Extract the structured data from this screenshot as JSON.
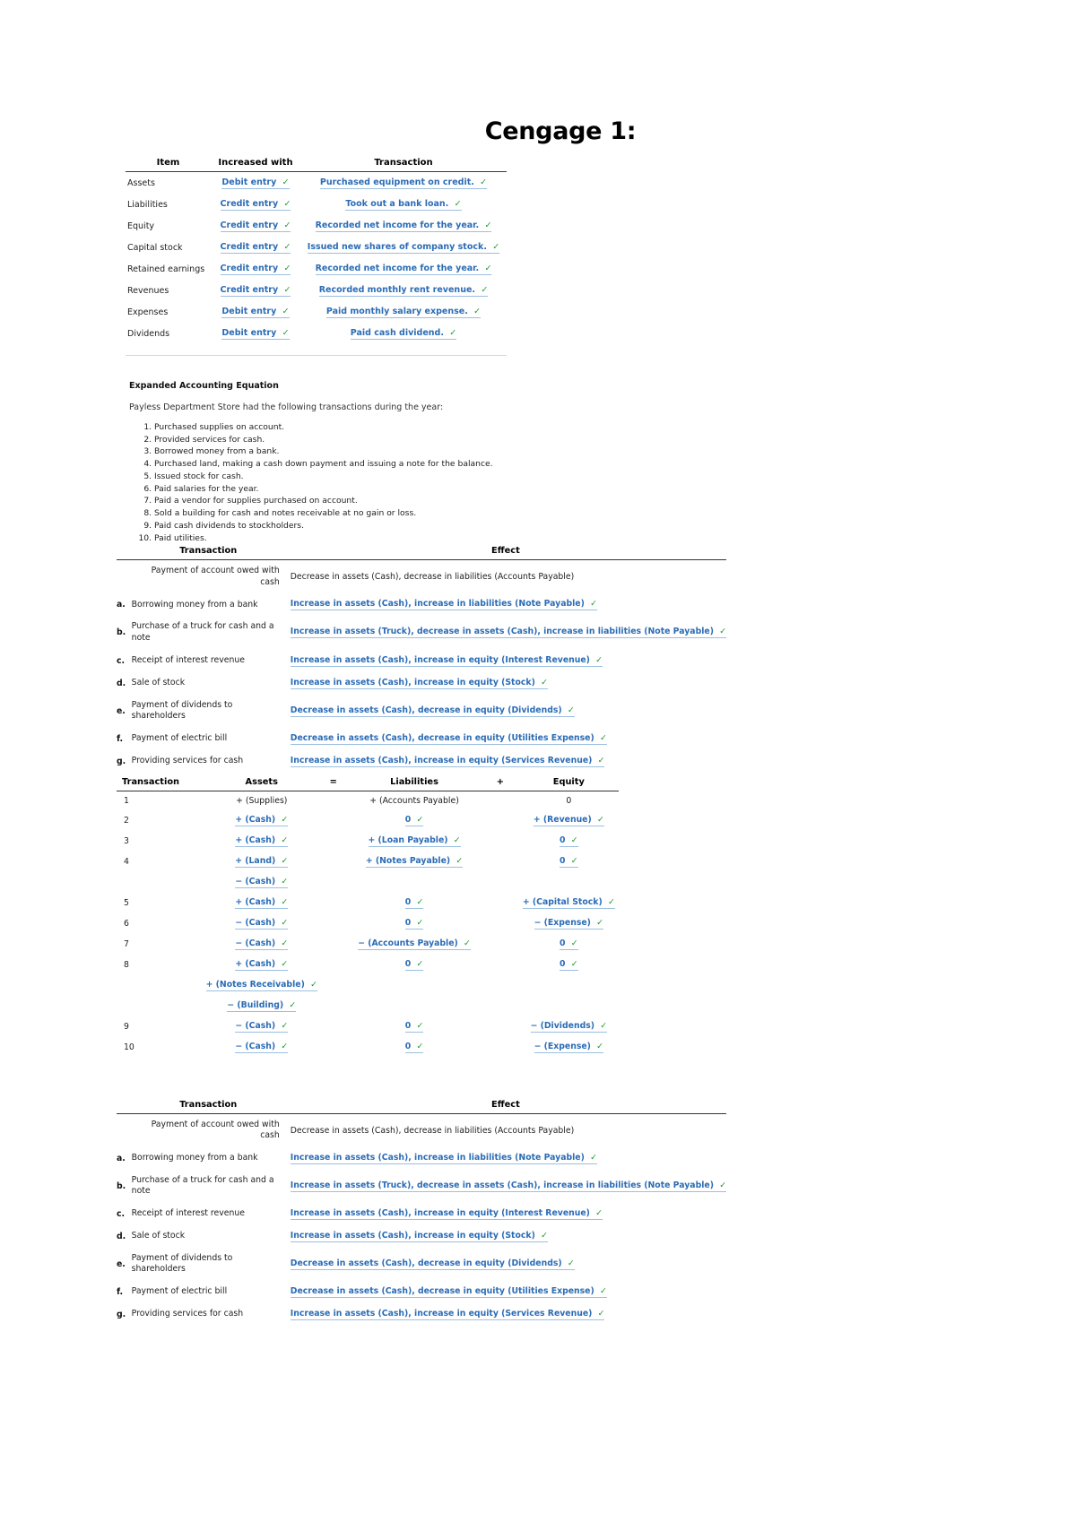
{
  "page": {
    "title": "Cengage 1:"
  },
  "colors": {
    "answer_blue": "#2b6cb6",
    "check_green": "#1d9b2f",
    "rule_dark": "#333333",
    "underline_blue": "#9cbfe0"
  },
  "icons": {
    "check": "✓"
  },
  "table_items": {
    "headers": [
      "Item",
      "Increased with",
      "Transaction"
    ],
    "rows": [
      {
        "item": "Assets",
        "increased_with": "Debit entry",
        "transaction": "Purchased equipment on credit."
      },
      {
        "item": "Liabilities",
        "increased_with": "Credit entry",
        "transaction": "Took out a bank loan."
      },
      {
        "item": "Equity",
        "increased_with": "Credit entry",
        "transaction": "Recorded net income for the year."
      },
      {
        "item": "Capital stock",
        "increased_with": "Credit entry",
        "transaction": "Issued new shares of company stock."
      },
      {
        "item": "Retained earnings",
        "increased_with": "Credit entry",
        "transaction": "Recorded net income for the year."
      },
      {
        "item": "Revenues",
        "increased_with": "Credit entry",
        "transaction": "Recorded monthly rent revenue."
      },
      {
        "item": "Expenses",
        "increased_with": "Debit entry",
        "transaction": "Paid monthly salary expense."
      },
      {
        "item": "Dividends",
        "increased_with": "Debit entry",
        "transaction": "Paid cash dividend."
      }
    ]
  },
  "expanded_section": {
    "heading": "Expanded Accounting Equation",
    "intro": "Payless Department Store had the following transactions during the year:",
    "transactions": [
      "Purchased supplies on account.",
      "Provided services for cash.",
      "Borrowed money from a bank.",
      "Purchased land, making a cash down payment and issuing a note for the balance.",
      "Issued stock for cash.",
      "Paid salaries for the year.",
      "Paid a vendor for supplies purchased on account.",
      "Sold a building for cash and notes receivable at no gain or loss.",
      "Paid cash dividends to stockholders.",
      "Paid utilities."
    ]
  },
  "effect_table": {
    "headers": [
      "Transaction",
      "Effect"
    ],
    "example": {
      "transaction": "Payment of account owed with cash",
      "effect": "Decrease in assets (Cash), decrease in liabilities (Accounts Payable)"
    },
    "rows": [
      {
        "label": "a.",
        "transaction": "Borrowing money from a bank",
        "effect": "Increase in assets (Cash), increase in liabilities (Note Payable)"
      },
      {
        "label": "b.",
        "transaction": "Purchase of a truck for cash and a note",
        "effect": "Increase in assets (Truck), decrease in assets (Cash), increase in liabilities (Note Payable)"
      },
      {
        "label": "c.",
        "transaction": "Receipt of interest revenue",
        "effect": "Increase in assets (Cash), increase in equity (Interest Revenue)"
      },
      {
        "label": "d.",
        "transaction": "Sale of stock",
        "effect": "Increase in assets (Cash), increase in equity (Stock)"
      },
      {
        "label": "e.",
        "transaction": "Payment of dividends to shareholders",
        "effect": "Decrease in assets (Cash), decrease in equity (Dividends)"
      },
      {
        "label": "f.",
        "transaction": "Payment of electric bill",
        "effect": "Decrease in assets (Cash), decrease in equity (Utilities Expense)"
      },
      {
        "label": "g.",
        "transaction": "Providing services for cash",
        "effect": "Increase in assets (Cash), increase in equity (Services Revenue)"
      }
    ]
  },
  "equation_table": {
    "headers": [
      "Transaction",
      "Assets",
      "=",
      "Liabilities",
      "+",
      "Equity"
    ],
    "rows": [
      {
        "n": "1",
        "assets": "+ (Supplies)",
        "liabilities": "+ (Accounts Payable)",
        "equity": "0",
        "answered": false
      },
      {
        "n": "2",
        "assets": "+ (Cash)",
        "liabilities": "0",
        "equity": "+ (Revenue)",
        "answered": true
      },
      {
        "n": "3",
        "assets": "+ (Cash)",
        "liabilities": "+ (Loan Payable)",
        "equity": "0",
        "answered": true
      },
      {
        "n": "4",
        "assets": "+ (Land)",
        "liabilities": "+ (Notes Payable)",
        "equity": "0",
        "answered": true
      },
      {
        "n": "",
        "assets": "− (Cash)",
        "liabilities": "",
        "equity": "",
        "answered": true
      },
      {
        "n": "5",
        "assets": "+ (Cash)",
        "liabilities": "0",
        "equity": "+ (Capital Stock)",
        "answered": true
      },
      {
        "n": "6",
        "assets": "− (Cash)",
        "liabilities": "0",
        "equity": "− (Expense)",
        "answered": true
      },
      {
        "n": "7",
        "assets": "− (Cash)",
        "liabilities": "− (Accounts Payable)",
        "equity": "0",
        "answered": true
      },
      {
        "n": "8",
        "assets": "+ (Cash)",
        "liabilities": "0",
        "equity": "0",
        "answered": true
      },
      {
        "n": "",
        "assets": "+ (Notes Receivable)",
        "liabilities": "",
        "equity": "",
        "answered": true
      },
      {
        "n": "",
        "assets": "− (Building)",
        "liabilities": "",
        "equity": "",
        "answered": true
      },
      {
        "n": "9",
        "assets": "− (Cash)",
        "liabilities": "0",
        "equity": "− (Dividends)",
        "answered": true
      },
      {
        "n": "10",
        "assets": "− (Cash)",
        "liabilities": "0",
        "equity": "− (Expense)",
        "answered": true
      }
    ]
  },
  "effect_table_2": {
    "headers": [
      "Transaction",
      "Effect"
    ],
    "example": {
      "transaction": "Payment of account owed with cash",
      "effect": "Decrease in assets (Cash), decrease in liabilities (Accounts Payable)"
    },
    "rows": [
      {
        "label": "a.",
        "transaction": "Borrowing money from a bank",
        "effect": "Increase in assets (Cash), increase in liabilities (Note Payable)"
      },
      {
        "label": "b.",
        "transaction": "Purchase of a truck for cash and a note",
        "effect": "Increase in assets (Truck), decrease in assets (Cash), increase in liabilities (Note Payable)"
      },
      {
        "label": "c.",
        "transaction": "Receipt of interest revenue",
        "effect": "Increase in assets (Cash), increase in equity (Interest Revenue)"
      },
      {
        "label": "d.",
        "transaction": "Sale of stock",
        "effect": "Increase in assets (Cash), increase in equity (Stock)"
      },
      {
        "label": "e.",
        "transaction": "Payment of dividends to shareholders",
        "effect": "Decrease in assets (Cash), decrease in equity (Dividends)"
      },
      {
        "label": "f.",
        "transaction": "Payment of electric bill",
        "effect": "Decrease in assets (Cash), decrease in equity (Utilities Expense)"
      },
      {
        "label": "g.",
        "transaction": "Providing services for cash",
        "effect": "Increase in assets (Cash), increase in equity (Services Revenue)"
      }
    ]
  }
}
